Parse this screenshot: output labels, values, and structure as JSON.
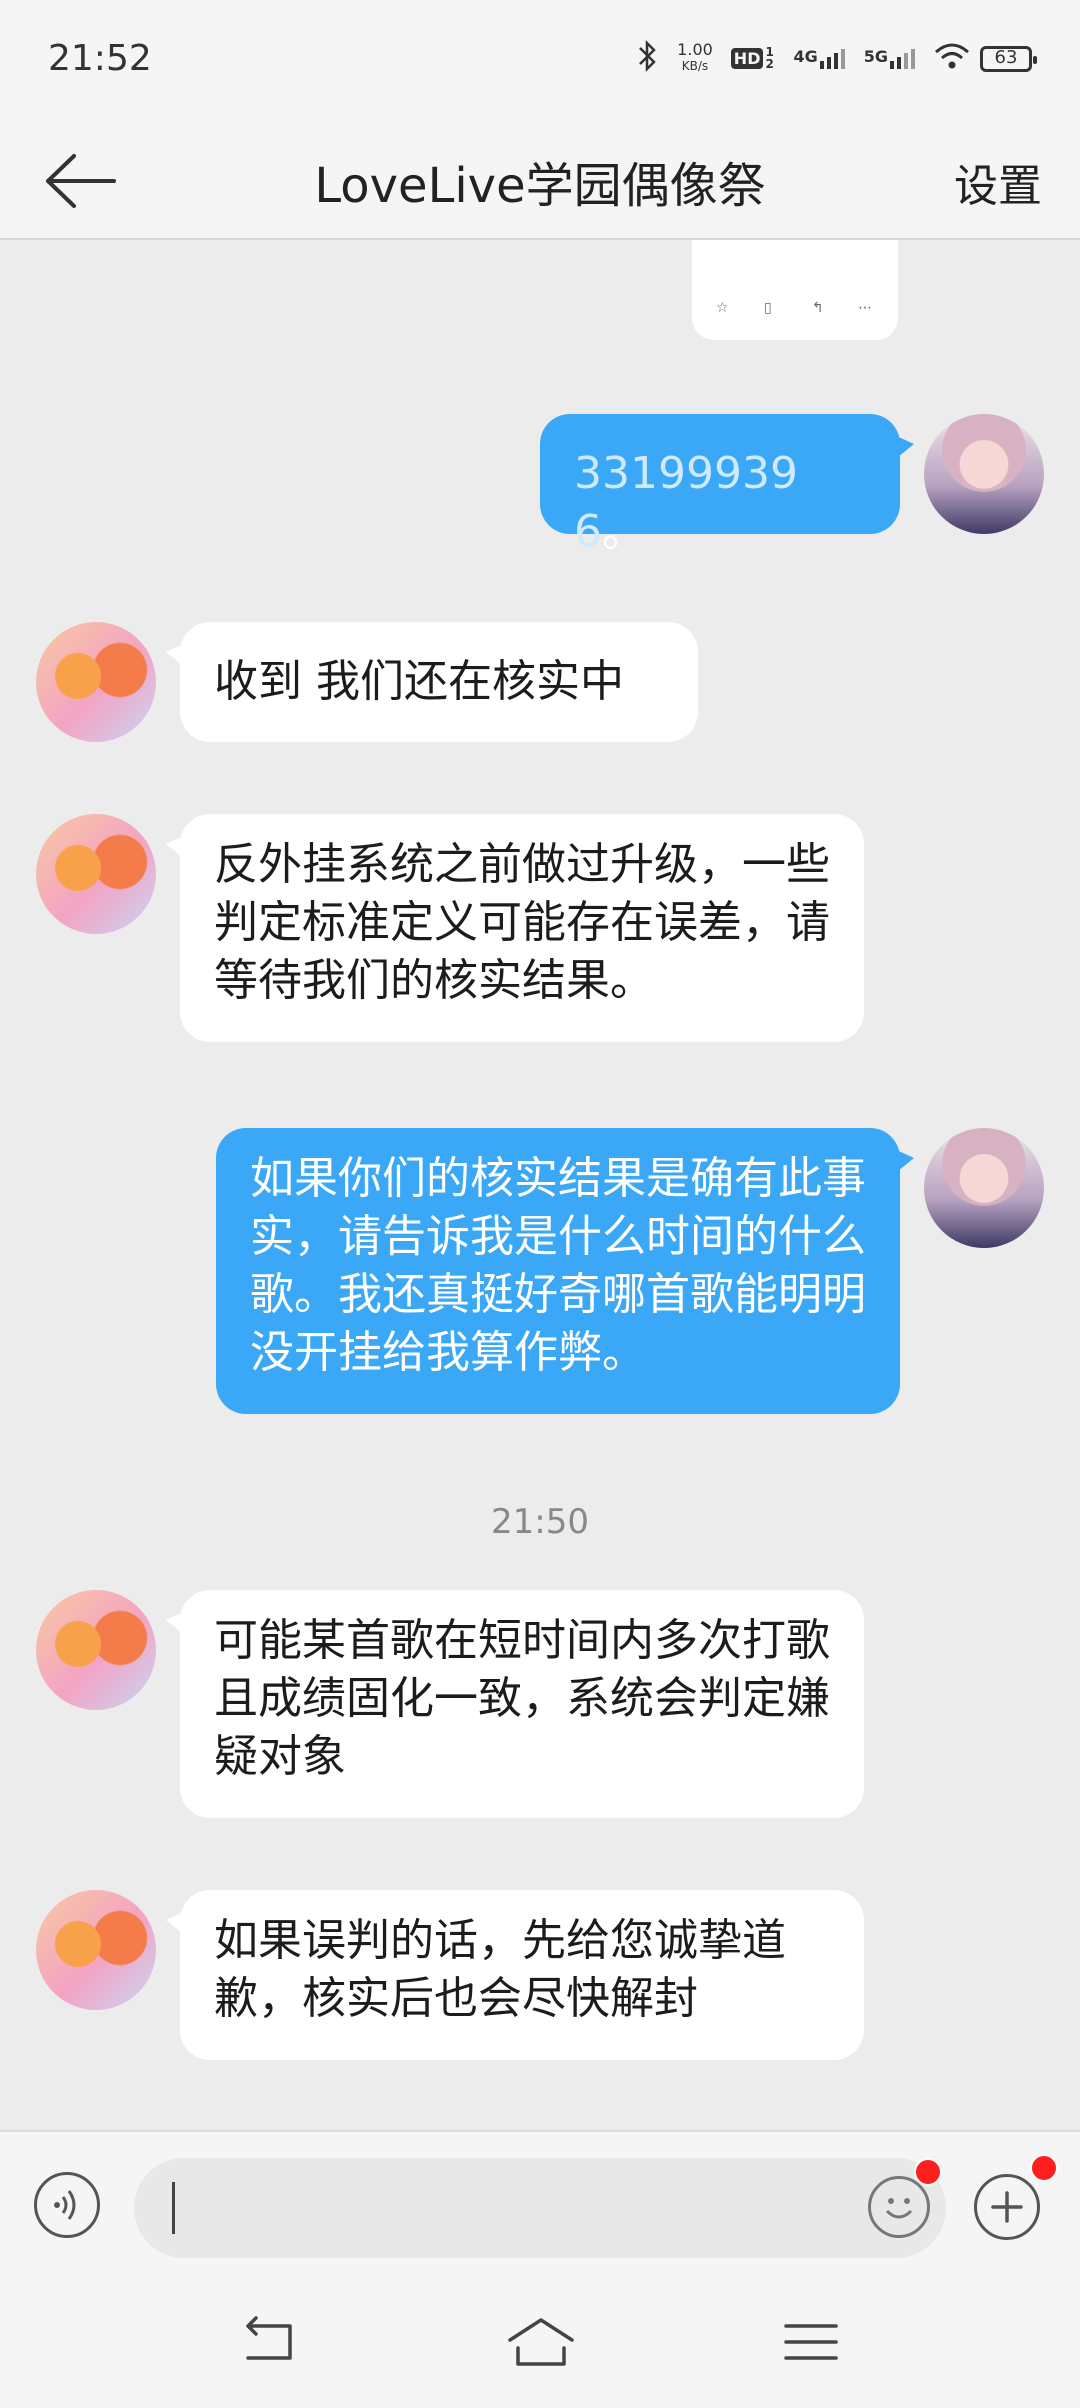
{
  "status": {
    "time": "21:52",
    "net_speed_value": "1.00",
    "net_speed_unit": "KB/s",
    "hd_label": "HD",
    "hd_sub": "1 2",
    "signal1_label": "4G",
    "signal2_label": "5G",
    "battery": "63"
  },
  "header": {
    "title": "LoveLive学园偶像祭",
    "settings_label": "设置"
  },
  "messages": [
    {
      "id": "m1",
      "side": "out",
      "text": "331999396",
      "suffix": "。"
    },
    {
      "id": "m2",
      "side": "in",
      "text": "收到 我们还在核实中"
    },
    {
      "id": "m3",
      "side": "in",
      "text": "反外挂系统之前做过升级，一些判定标准定义可能存在误差，请等待我们的核实结果。"
    },
    {
      "id": "m4",
      "side": "out",
      "text": "如果你们的核实结果是确有此事实，请告诉我是什么时间的什么歌。我还真挺好奇哪首歌能明明没开挂给我算作弊。"
    },
    {
      "id": "m5",
      "side": "in",
      "text": "可能某首歌在短时间内多次打歌且成绩固化一致，系统会判定嫌疑对象"
    },
    {
      "id": "m6",
      "side": "in",
      "text": "如果误判的话，先给您诚挚道歉，核实后也会尽快解封"
    }
  ],
  "time_separator": "21:50",
  "input": {
    "value": "",
    "placeholder": ""
  },
  "icons": {
    "back": "arrow-left-icon",
    "voice": "voice-icon",
    "emoji": "emoji-icon",
    "plus": "plus-icon",
    "nav_back": "nav-back-icon",
    "nav_home": "nav-home-icon",
    "nav_menu": "nav-menu-icon"
  },
  "colors": {
    "outgoing_bubble": "#3aa8f6",
    "incoming_bubble": "#ffffff",
    "chat_background": "#ececec",
    "notification_dot": "#ff1f1f"
  }
}
